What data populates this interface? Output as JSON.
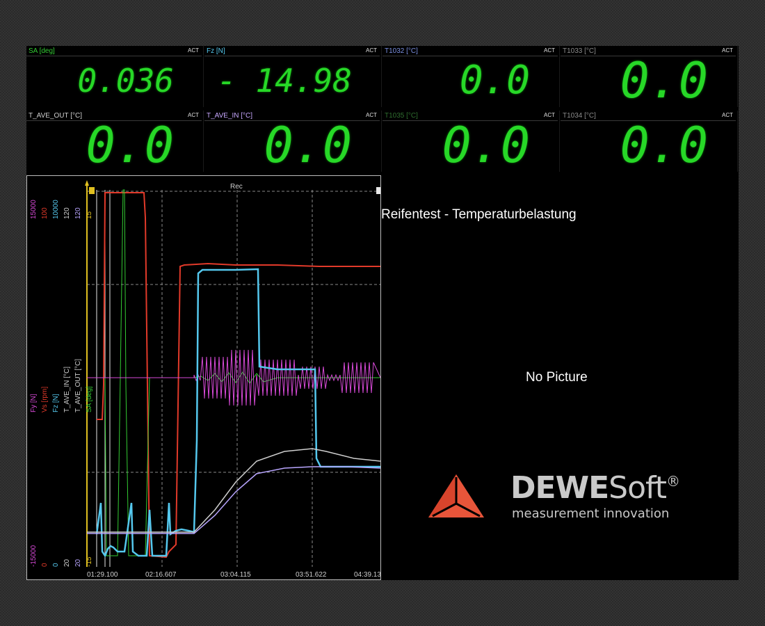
{
  "meters": [
    {
      "label": "SA [deg]",
      "label_color": "#33cc33",
      "act": "ACT",
      "value": "0.036",
      "size": 46
    },
    {
      "label": "Fz [N]",
      "label_color": "#55c8ee",
      "act": "ACT",
      "value": "- 14.98",
      "size": 46
    },
    {
      "label": "T1032 [°C]",
      "label_color": "#7a8fe0",
      "act": "ACT",
      "value": "0.0",
      "size": 56
    },
    {
      "label": "T1033 [°C]",
      "label_color": "#8c8c8c",
      "act": "ACT",
      "value": "0.0",
      "size": 70
    },
    {
      "label": "T_AVE_OUT [°C]",
      "label_color": "#cfcfcf",
      "act": "ACT",
      "value": "0.0",
      "size": 70
    },
    {
      "label": "T_AVE_IN [°C]",
      "label_color": "#c8a8ff",
      "act": "ACT",
      "value": "0.0",
      "size": 70
    },
    {
      "label": "T1035 [°C]",
      "label_color": "#2f6f2f",
      "act": "ACT",
      "value": "0.0",
      "size": 70
    },
    {
      "label": "T1034 [°C]",
      "label_color": "#8c8c8c",
      "act": "ACT",
      "value": "0.0",
      "size": 70
    }
  ],
  "chart": {
    "rec_label": "Rec",
    "time_labels": [
      "01:29.100",
      "02:16.607",
      "03:04.115",
      "03:51.622",
      "04:39.13"
    ],
    "axes": [
      {
        "top": "15000",
        "bottom": "-15000",
        "color": "#d94ad9"
      },
      {
        "top": "100",
        "bottom": "0",
        "color": "#e23a2a"
      },
      {
        "top": "10000",
        "bottom": "0",
        "color": "#55c8ee"
      },
      {
        "top": "120",
        "bottom": "20",
        "color": "#cfcfcf"
      },
      {
        "top": "120",
        "bottom": "20",
        "color": "#b9a6ff"
      },
      {
        "top": "15",
        "bottom": "-15",
        "color": "#e0c020"
      }
    ],
    "series_labels": [
      {
        "text": "Fy [N]",
        "color": "#d94ad9"
      },
      {
        "text": "Vs [rpm]",
        "color": "#e23a2a"
      },
      {
        "text": "Fz [N]",
        "color": "#55c8ee"
      },
      {
        "text": "T_AVE_IN [°C]",
        "color": "#cfcfcf"
      },
      {
        "text": "T_AVE_OUT [°C]",
        "color": "#cfcfcf"
      },
      {
        "text": "SA [deg]",
        "color": "#33cc33"
      }
    ]
  },
  "title": "Reifentest - Temperaturbelastung",
  "no_picture": "No Picture",
  "logo": {
    "name_bold": "DEWE",
    "name_regular": "Soft",
    "registered": "®",
    "tagline": "measurement innovation"
  }
}
